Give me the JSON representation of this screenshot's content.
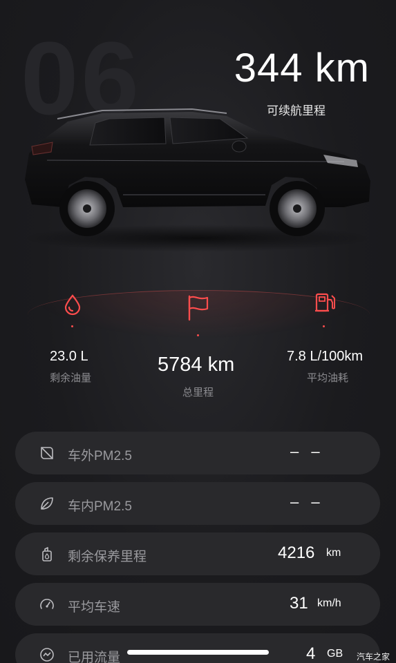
{
  "background_number": "06",
  "range": {
    "value": "344 km",
    "label": "可续航里程"
  },
  "stats": {
    "fuel": {
      "icon": "water-drop-icon",
      "value": "23.0 L",
      "label": "剩余油量"
    },
    "odometer": {
      "icon": "flag-icon",
      "value": "5784 km",
      "label": "总里程"
    },
    "consumption": {
      "icon": "fuel-pump-icon",
      "value": "7.8 L/100km",
      "label": "平均油耗"
    }
  },
  "rows": [
    {
      "icon": "leaf-outline-icon",
      "label": "车外PM2.5",
      "value": "– –",
      "unit": ""
    },
    {
      "icon": "leaf-icon",
      "label": "车内PM2.5",
      "value": "– –",
      "unit": ""
    },
    {
      "icon": "oil-can-icon",
      "label": "剩余保养里程",
      "value": "4216",
      "unit": "km"
    },
    {
      "icon": "speedometer-icon",
      "label": "平均车速",
      "value": "31",
      "unit": "km/h"
    },
    {
      "icon": "data-usage-icon",
      "label": "已用流量",
      "value": "4",
      "unit": "GB"
    }
  ],
  "watermark": "汽车之家",
  "colors": {
    "accent": "#ff4d4d",
    "background": "#1b1b1e",
    "row_background": "#29292c",
    "label_gray": "#8c8c90"
  }
}
